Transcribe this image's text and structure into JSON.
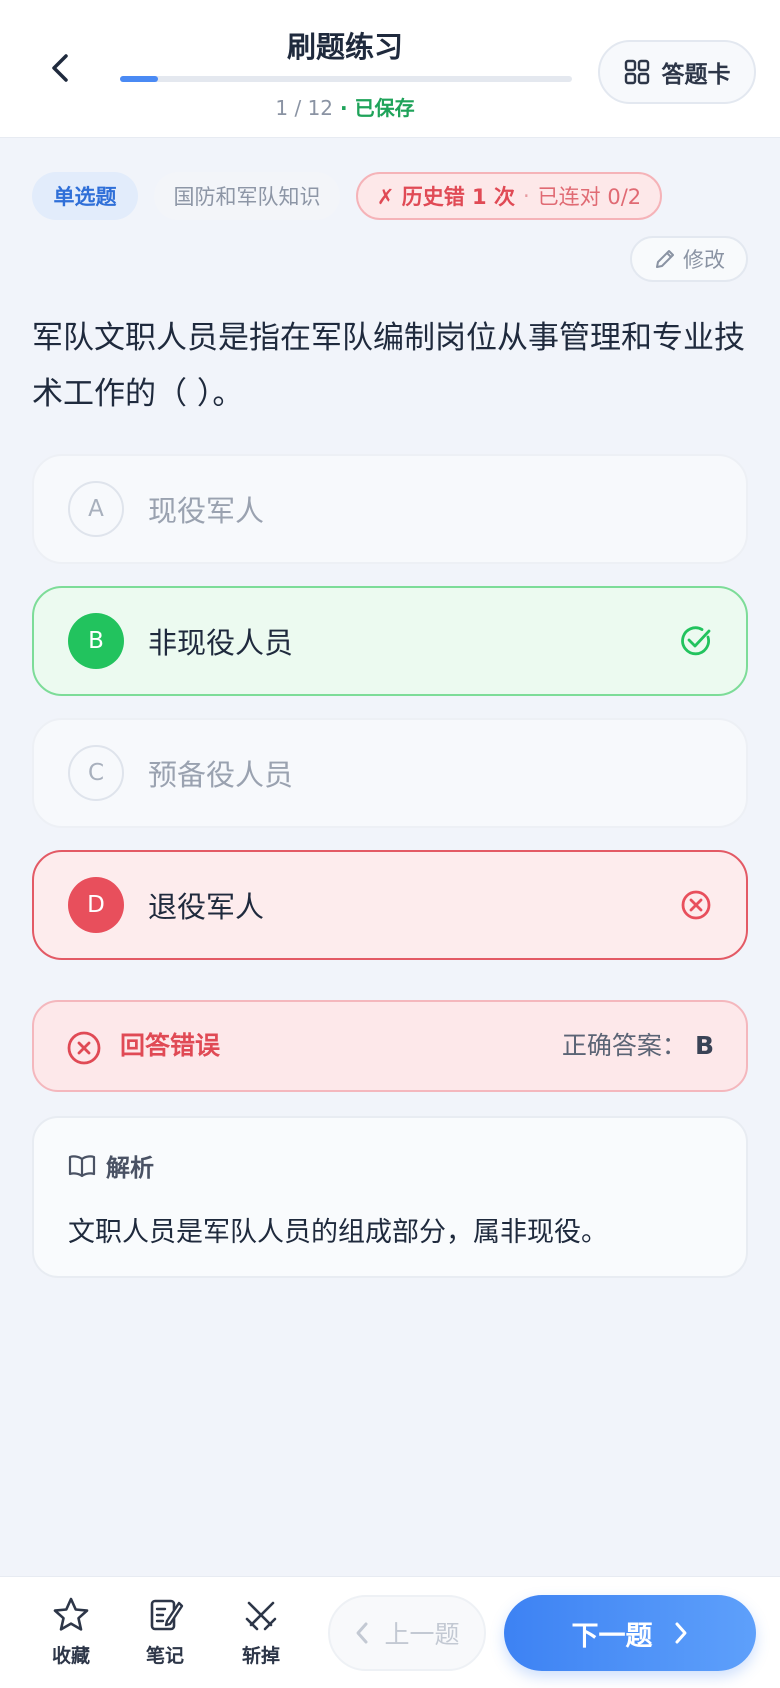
{
  "header": {
    "title": "刷题练习",
    "progress_text": "1 / 12",
    "progress_sep": " · ",
    "saved_label": "已保存",
    "progress_fraction": 0.0833,
    "answer_card_label": "答题卡"
  },
  "tags": {
    "type": "单选题",
    "category": "国防和军队知识",
    "history_wrong": "✗ 历史错 1 次",
    "history_sep": "·",
    "streak": "已连对 0/2"
  },
  "edit_label": "修改",
  "question": "军队文职人员是指在军队编制岗位从事管理和专业技术工作的（ ）。",
  "options": [
    {
      "letter": "A",
      "text": "现役军人",
      "state": "plain"
    },
    {
      "letter": "B",
      "text": "非现役人员",
      "state": "correct"
    },
    {
      "letter": "C",
      "text": "预备役人员",
      "state": "plain"
    },
    {
      "letter": "D",
      "text": "退役军人",
      "state": "wrong"
    }
  ],
  "result": {
    "label": "回答错误",
    "answer_prefix": "正确答案：",
    "answer": "B"
  },
  "analysis": {
    "title": "解析",
    "body": "文职人员是军队人员的组成部分，属非现役。"
  },
  "bottom": {
    "favorite": "收藏",
    "note": "笔记",
    "cut": "斩掉",
    "prev": "上一题",
    "next": "下一题"
  },
  "colors": {
    "accent": "#3d82f3",
    "correct": "#22c35e",
    "wrong": "#e84f5c",
    "saved": "#1fa35a"
  }
}
